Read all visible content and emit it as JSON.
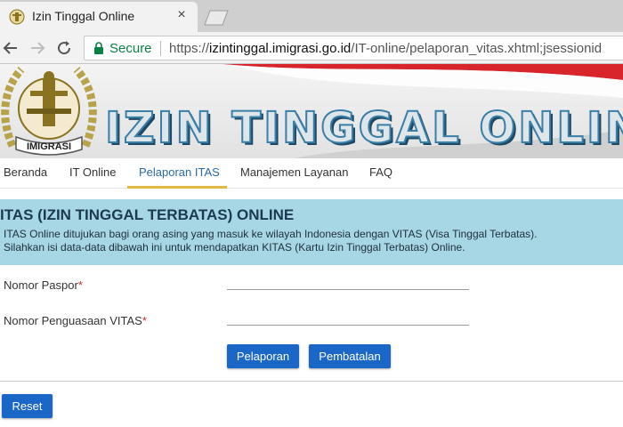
{
  "browser": {
    "tab_title": "Izin Tinggal Online",
    "tab_close": "×",
    "secure_label": "Secure",
    "url_scheme": "https://",
    "url_host": "izintinggal.imigrasi.go.id",
    "url_path": "/IT-online/pelaporan_vitas.xhtml;jsessionid"
  },
  "banner": {
    "title": "IZIN TINGGAL ONLINE",
    "seal_text": "IMIGRASI"
  },
  "nav": {
    "items": [
      {
        "label": "Beranda"
      },
      {
        "label": "IT Online"
      },
      {
        "label": "Pelaporan ITAS"
      },
      {
        "label": "Manajemen Layanan"
      },
      {
        "label": "FAQ"
      }
    ],
    "active_index": 2
  },
  "info": {
    "title": "ITAS (IZIN TINGGAL TERBATAS) ONLINE",
    "line1": "ITAS Online ditujukan bagi orang asing yang masuk ke wilayah Indonesia dengan VITAS (Visa Tinggal Terbatas).",
    "line2": "Silahkan isi data-data dibawah ini untuk mendapatkan KITAS (Kartu Izin Tinggal Terbatas) Online."
  },
  "form": {
    "passport_label": "Nomor Paspor",
    "vitas_label": "Nomor Penguasaan VITAS",
    "required_marker": "*",
    "passport_value": "",
    "vitas_value": "",
    "submit_label": "Pelaporan",
    "cancel_label": "Pembatalan",
    "reset_label": "Reset"
  },
  "colors": {
    "accent_blue": "#1a67c8",
    "nav_active": "#2a6aa6",
    "nav_underline": "#e0b93f",
    "info_bg": "#a7d6e4",
    "required": "#d2232a",
    "secure_green": "#0b8043"
  }
}
